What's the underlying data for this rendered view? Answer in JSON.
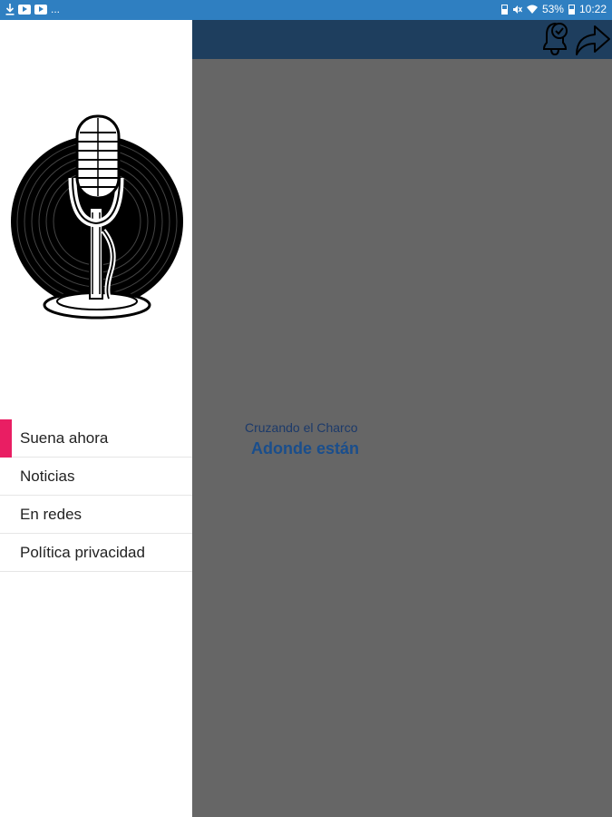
{
  "status_bar": {
    "left_icons": [
      "download-icon",
      "youtube-icon",
      "youtube-icon"
    ],
    "overflow": "...",
    "battery_percent": "53%",
    "time": "10:22"
  },
  "drawer": {
    "menu": [
      {
        "label": "Suena ahora",
        "active": true
      },
      {
        "label": "Noticias",
        "active": false
      },
      {
        "label": "En redes",
        "active": false
      },
      {
        "label": "Política privacidad",
        "active": false
      }
    ],
    "accent_color": "#e91e63"
  },
  "app_bar": {
    "icons": [
      "alarm-bell-check-icon",
      "share-arrow-icon"
    ],
    "color": "#1e3e5e"
  },
  "now_playing": {
    "show": "Cruzando el Charco",
    "title": "Adonde están"
  }
}
